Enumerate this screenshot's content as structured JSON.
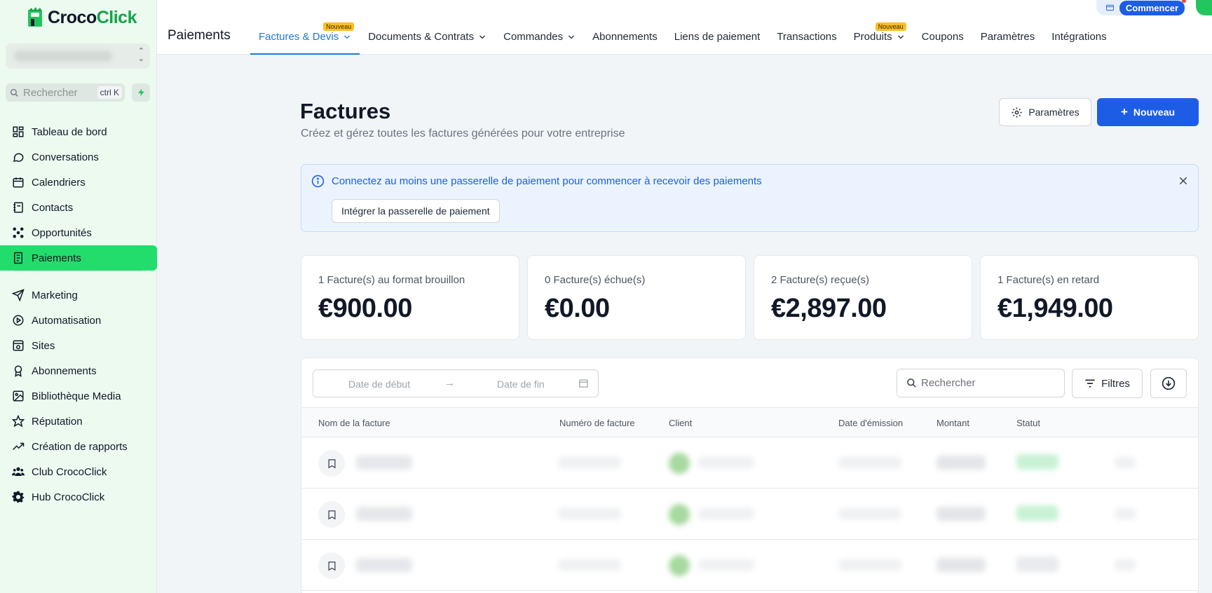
{
  "brand": {
    "name_part1": "Croco",
    "name_part2": "Click"
  },
  "sidebar": {
    "search_placeholder": "Rechercher",
    "search_shortcut": "ctrl K",
    "items_top": [
      {
        "label": "Tableau de bord",
        "icon": "dashboard-icon"
      },
      {
        "label": "Conversations",
        "icon": "chat-icon"
      },
      {
        "label": "Calendriers",
        "icon": "calendar-icon"
      },
      {
        "label": "Contacts",
        "icon": "contacts-icon"
      },
      {
        "label": "Opportunités",
        "icon": "opportunities-icon"
      },
      {
        "label": "Paiements",
        "icon": "payments-icon",
        "active": true
      }
    ],
    "items_bottom": [
      {
        "label": "Marketing",
        "icon": "send-icon"
      },
      {
        "label": "Automatisation",
        "icon": "automation-icon"
      },
      {
        "label": "Sites",
        "icon": "sites-icon"
      },
      {
        "label": "Abonnements",
        "icon": "award-icon"
      },
      {
        "label": "Bibliothèque Media",
        "icon": "image-icon"
      },
      {
        "label": "Réputation",
        "icon": "star-icon"
      },
      {
        "label": "Création de rapports",
        "icon": "trend-icon"
      },
      {
        "label": "Club CrocoClick",
        "icon": "users-icon"
      },
      {
        "label": "Hub CrocoClick",
        "icon": "gear-icon"
      }
    ]
  },
  "topbar": {
    "title": "Paiements",
    "commencer": "Commencer",
    "tabs": [
      {
        "label": "Factures & Devis",
        "dropdown": true,
        "active": true,
        "badge": "Nouveau"
      },
      {
        "label": "Documents & Contrats",
        "dropdown": true
      },
      {
        "label": "Commandes",
        "dropdown": true
      },
      {
        "label": "Abonnements"
      },
      {
        "label": "Liens de paiement"
      },
      {
        "label": "Transactions"
      },
      {
        "label": "Produits",
        "dropdown": true,
        "badge": "Nouveau"
      },
      {
        "label": "Coupons"
      },
      {
        "label": "Paramètres"
      },
      {
        "label": "Intégrations"
      }
    ]
  },
  "page": {
    "title": "Factures",
    "subtitle": "Créez et gérez toutes les factures générées pour votre entreprise",
    "settings_button": "Paramètres",
    "new_button": "Nouveau"
  },
  "alert": {
    "text": "Connectez au moins une passerelle de paiement pour commencer à recevoir des paiements",
    "button": "Intégrer la passerelle de paiement"
  },
  "stats": [
    {
      "label": "1 Facture(s) au format brouillon",
      "value": "€900.00"
    },
    {
      "label": "0 Facture(s) échue(s)",
      "value": "€0.00"
    },
    {
      "label": "2 Facture(s) reçue(s)",
      "value": "€2,897.00"
    },
    {
      "label": "1 Facture(s) en retard",
      "value": "€1,949.00"
    }
  ],
  "table": {
    "date_start_placeholder": "Date de début",
    "date_end_placeholder": "Date de fin",
    "search_placeholder": "Rechercher",
    "filters_button": "Filtres",
    "columns": [
      "Nom de la facture",
      "Numéro de facture",
      "Client",
      "Date d'émission",
      "Montant",
      "Statut"
    ]
  },
  "colors": {
    "accent": "#1d5de6",
    "brand_green": "#22dd6b",
    "link_blue": "#1d78d6"
  }
}
